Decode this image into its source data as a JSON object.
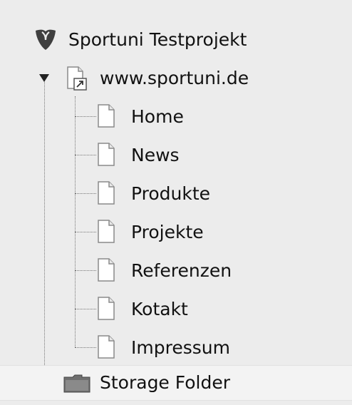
{
  "tree": {
    "root": {
      "label": "Sportuni Testprojekt",
      "icon": "typo3-logo-icon"
    },
    "site": {
      "label": "www.sportuni.de",
      "icon": "site-page-icon",
      "expanded": true
    },
    "pages": [
      {
        "label": "Home"
      },
      {
        "label": "News"
      },
      {
        "label": "Produkte"
      },
      {
        "label": "Projekte"
      },
      {
        "label": "Referenzen"
      },
      {
        "label": "Kotakt"
      },
      {
        "label": "Impressum"
      }
    ],
    "folder": {
      "label": "Storage Folder",
      "icon": "folder-icon"
    }
  },
  "colors": {
    "background": "#ececec",
    "logo": "#3f3f3f",
    "dotted_line": "#777777"
  }
}
